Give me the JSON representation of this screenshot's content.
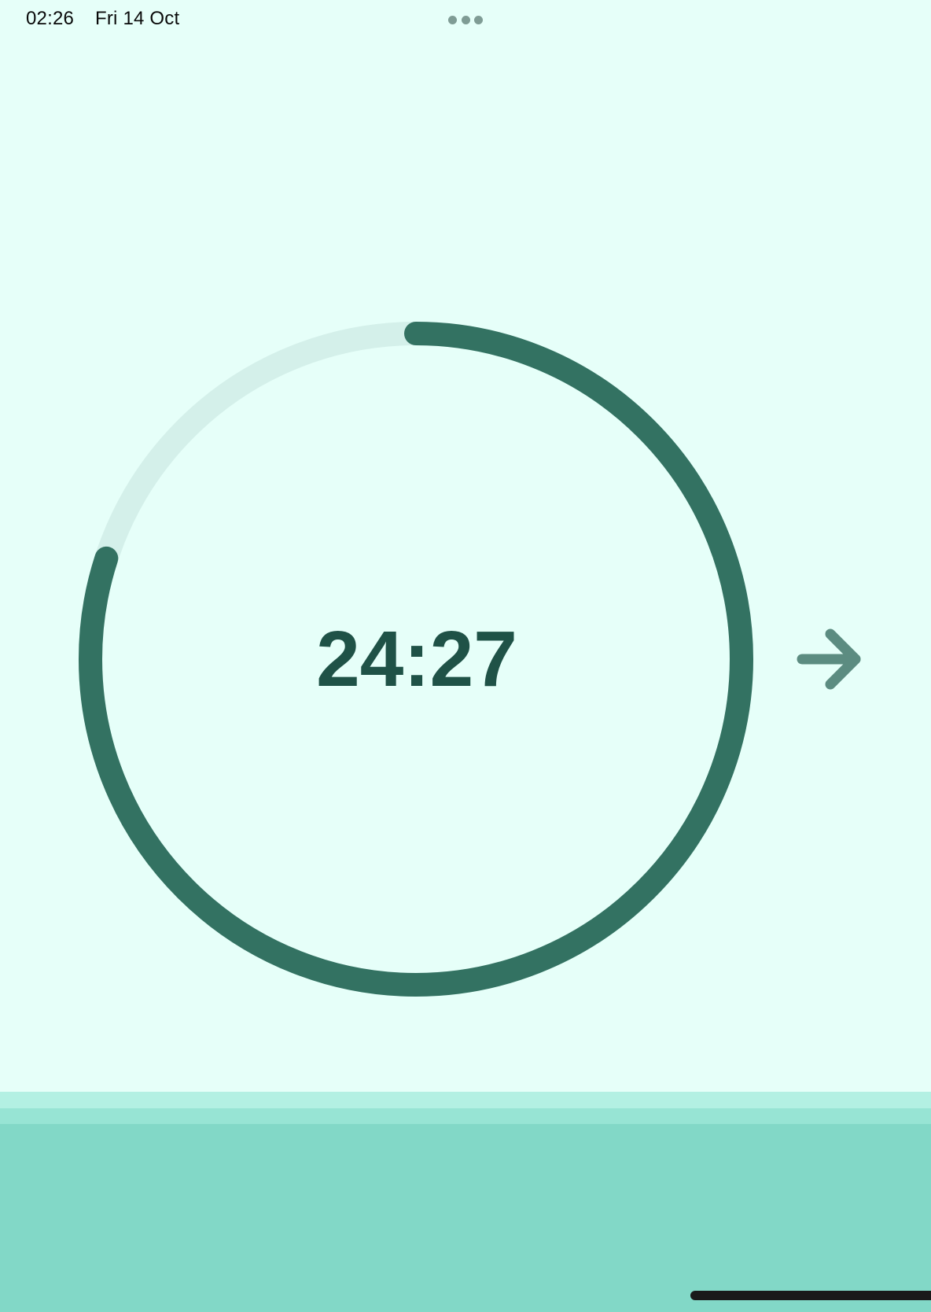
{
  "status_bar": {
    "time": "02:26",
    "date": "Fri 14 Oct"
  },
  "timer": {
    "display": "24:27",
    "progress_fraction": 0.8,
    "colors": {
      "progress": "#337262",
      "track": "#d4f0ea",
      "text": "#1f5247"
    }
  },
  "controls": {
    "next_icon": "arrow-right-icon",
    "multitasking_icon": "ellipsis-icon"
  },
  "theme": {
    "background": "#e6fff9",
    "panel": "#82d8c7",
    "arrow": "#5c8c81"
  }
}
